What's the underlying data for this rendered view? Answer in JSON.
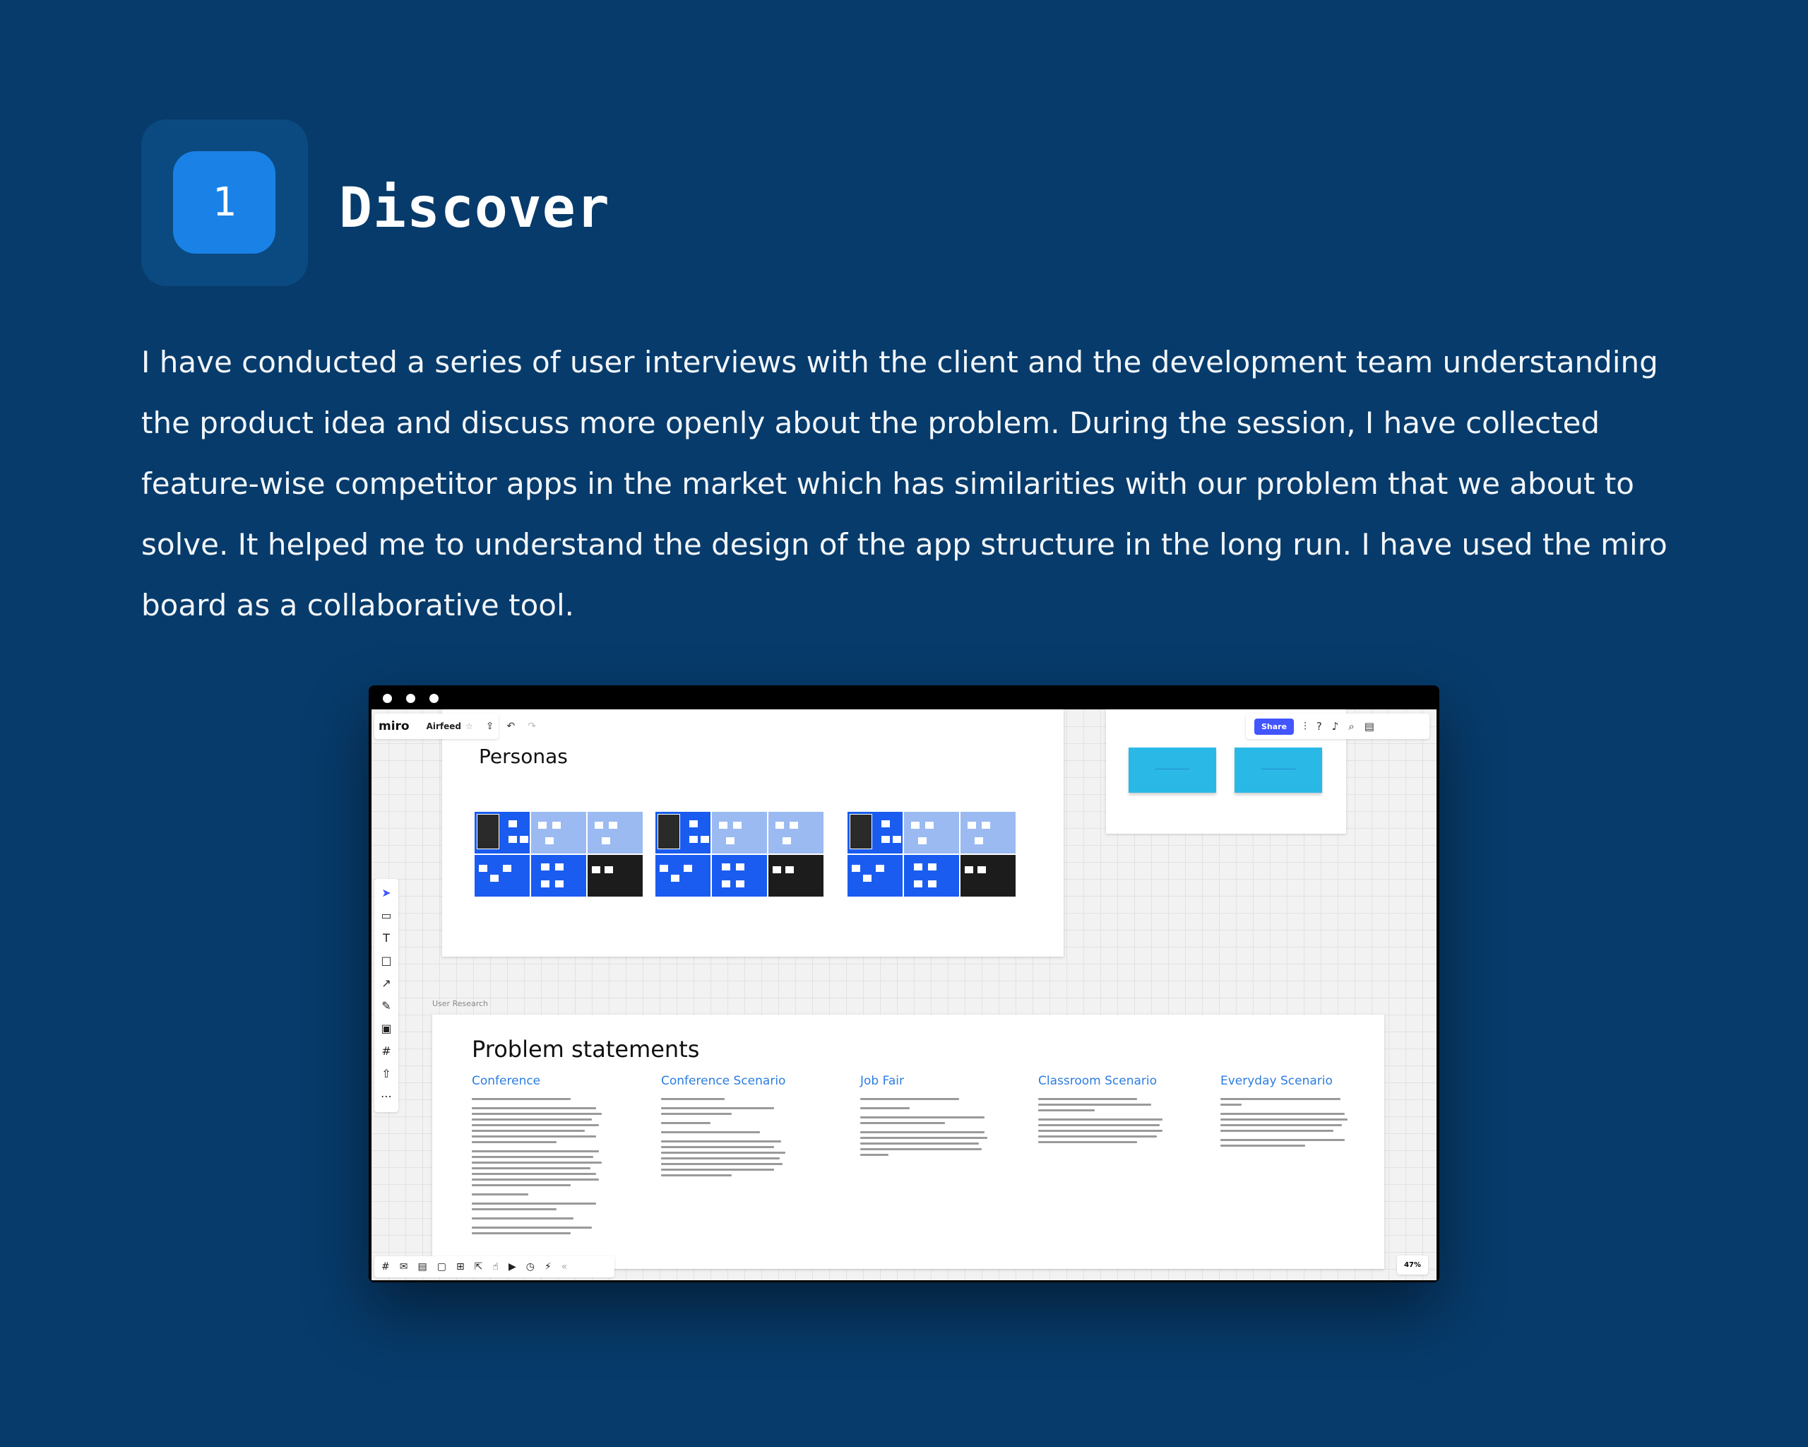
{
  "section": {
    "number": "1",
    "title": "Discover"
  },
  "intro": "I have conducted a series of user interviews with the client and the development team understanding the product idea and discuss more openly about the problem. During the session, I have collected feature-wise competitor apps in the market which has similarities with our problem that we about to solve.  It helped me to understand the design of the app structure in the long run. I have used the miro board as a collaborative tool.",
  "miro": {
    "logo": "miro",
    "board_name": "Airfeed",
    "share_label": "Share",
    "zoom": "47%",
    "personas_title": "Personas",
    "user_research_label": "User Research",
    "problems_title": "Problem statements",
    "problem_columns": [
      "Conference",
      "Conference Scenario",
      "Job Fair",
      "Classroom Scenario",
      "Everyday Scenario"
    ]
  }
}
